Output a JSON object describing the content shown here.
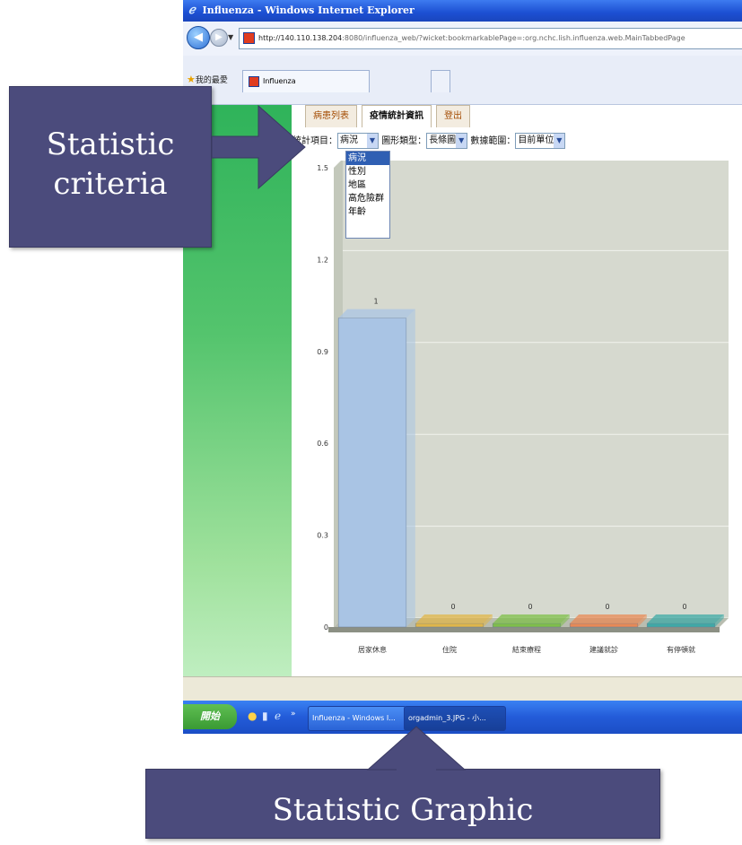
{
  "window": {
    "title": "Influenza - Windows Internet Explorer",
    "url_host": "http://140.110.138.204",
    "url_rest": ":8080/influenza_web/?wicket:bookmarkablePage=:org.nchc.lish.influenza.web.MainTabbedPage",
    "favorites_label": "我的最愛",
    "tab_label": "Influenza"
  },
  "app_tabs": [
    {
      "label": "病患列表"
    },
    {
      "label": "疫情統計資訊"
    },
    {
      "label": "登出"
    }
  ],
  "criteria": {
    "item_label": "統計項目：",
    "item_value": "病況",
    "type_label": "圖形類型：",
    "type_value": "長條圖",
    "range_label": "數據範圍：",
    "range_value": "目前單位"
  },
  "dropdown_options": [
    "病況",
    "性別",
    "地區",
    "高危險群",
    "年齡"
  ],
  "chart_data": {
    "type": "bar",
    "categories": [
      "居家休息",
      "住院",
      "結束療程",
      "建議就診",
      "有停頓就"
    ],
    "values": [
      1,
      0,
      0,
      0,
      0
    ],
    "value_labels": [
      "1",
      "0",
      "0",
      "0",
      "0"
    ],
    "yticks": [
      "0",
      "0.3",
      "0.6",
      "0.9",
      "1.2",
      "1.5"
    ],
    "ylim": [
      0,
      1.5
    ],
    "grid": true
  },
  "taskbar": {
    "start_label": "開始",
    "item1": "Influenza - Windows I...",
    "item2": "orgadmin_3.JPG - 小..."
  },
  "callouts": {
    "criteria_line1": "Statistic",
    "criteria_line2": "criteria",
    "graphic": "Statistic Graphic"
  },
  "colors": {
    "callout_bg": "#4b4b7c",
    "bar_colors": [
      "#a9c4e4",
      "#e0b64a",
      "#7fbf4a",
      "#e88a56",
      "#3fa9a6"
    ]
  }
}
